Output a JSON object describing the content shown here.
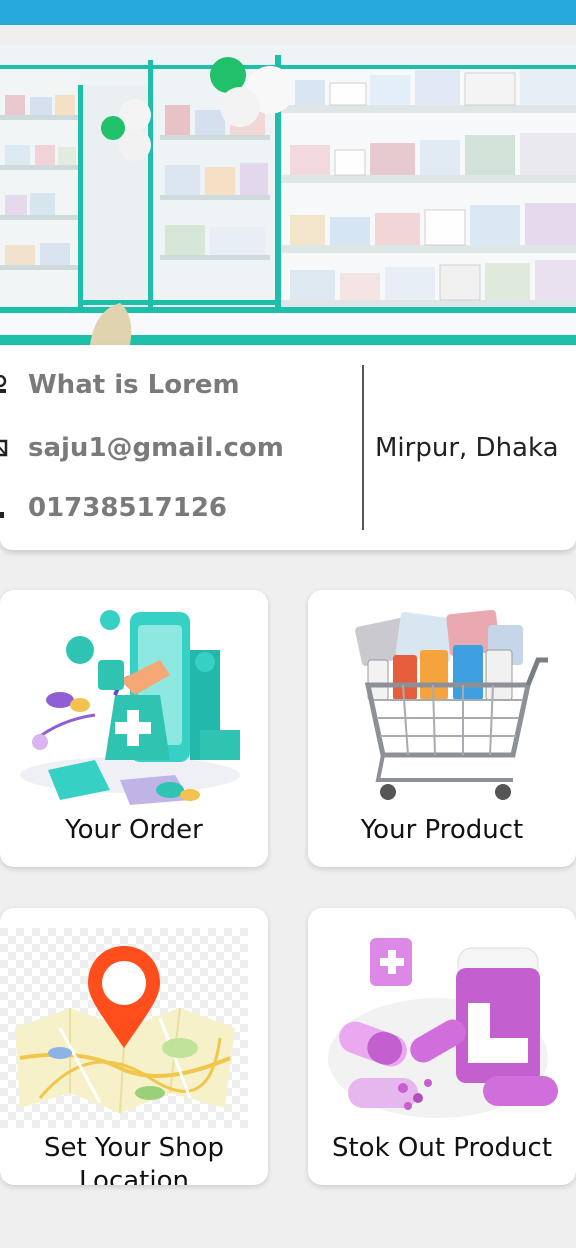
{
  "profile": {
    "name": "What is Lorem",
    "email": "saju1@gmail.com",
    "phone": "01738517126",
    "address": "Mirpur, Dhaka"
  },
  "menu": {
    "your_order": "Your Order",
    "your_product": "Your Product",
    "set_location_line1": "Set Your Shop",
    "set_location_line2": "Location",
    "stock_out": "Stok Out Product"
  },
  "colors": {
    "top_bar": "#27a8dc",
    "accent_teal": "#2fc4b2",
    "pin_red": "#ff4d1c",
    "purple": "#c06ad0"
  }
}
